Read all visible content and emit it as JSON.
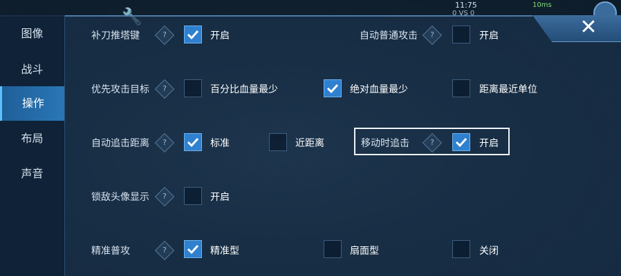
{
  "hud": {
    "clock": "11:75",
    "score": "0 VS 0",
    "network": "10ms"
  },
  "sidebar": {
    "items": [
      {
        "label": "图像",
        "active": false
      },
      {
        "label": "战斗",
        "active": false
      },
      {
        "label": "操作",
        "active": true
      },
      {
        "label": "布局",
        "active": false
      },
      {
        "label": "声音",
        "active": false
      }
    ]
  },
  "close_icon": "✕",
  "settings": {
    "last_hit_tower": {
      "label": "补刀推塔键",
      "option": {
        "label": "开启",
        "checked": true
      }
    },
    "auto_attack": {
      "label": "自动普通攻击",
      "option": {
        "label": "开启",
        "checked": false
      }
    },
    "target_priority": {
      "label": "优先攻击目标",
      "options": [
        {
          "label": "百分比血量最少",
          "checked": false
        },
        {
          "label": "绝对血量最少",
          "checked": true
        },
        {
          "label": "距离最近单位",
          "checked": false
        }
      ]
    },
    "auto_chase": {
      "label": "自动追击距离",
      "options": [
        {
          "label": "标准",
          "checked": true
        },
        {
          "label": "近距离",
          "checked": false
        }
      ]
    },
    "move_chase": {
      "label": "移动时追击",
      "option": {
        "label": "开启",
        "checked": true
      }
    },
    "lock_portrait": {
      "label": "锁敌头像显示",
      "option": {
        "label": "开启",
        "checked": false
      }
    },
    "precise_attack": {
      "label": "精准普攻",
      "options": [
        {
          "label": "精准型",
          "checked": true
        },
        {
          "label": "扇面型",
          "checked": false
        },
        {
          "label": "关闭",
          "checked": false
        }
      ]
    }
  },
  "help_glyph": "?",
  "colors": {
    "accent": "#2f80cf",
    "panel": "#162c44",
    "active_tab": "#2a76b6"
  }
}
